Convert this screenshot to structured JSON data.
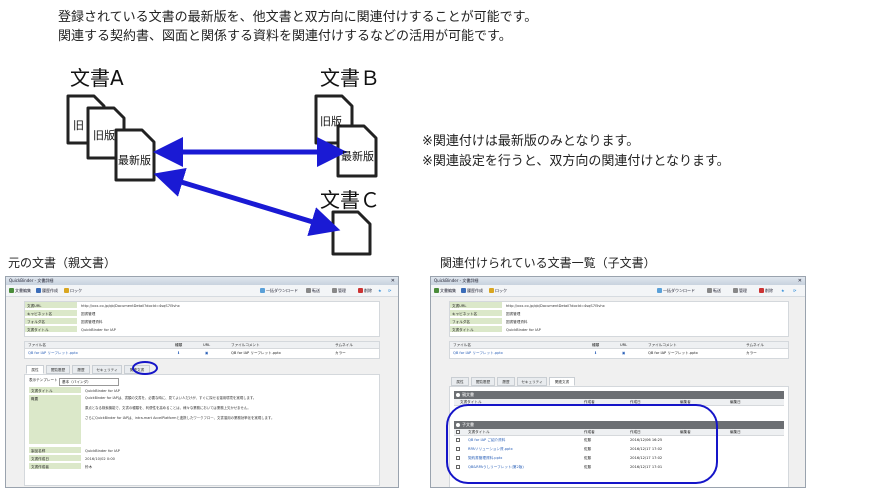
{
  "intro": {
    "line1": "登録されている文書の最新版を、他文書と双方向に関連付けすることが可能です。",
    "line2": "関連する契約書、図面と関係する資料を関連付けするなどの活用が可能です。"
  },
  "diagram": {
    "doc_a_title": "文書A",
    "doc_b_title": "文書Ｂ",
    "doc_c_title": "文書Ｃ",
    "doc_a_pages": [
      "旧",
      "旧版",
      "最新版"
    ],
    "doc_b_pages": [
      "旧版",
      "最新版"
    ],
    "arrow_color": "#1a1ad4",
    "notes": [
      "※関連付けは最新版のみとなります。",
      "※関連設定を行うと、双方向の関連付けとなります。"
    ]
  },
  "captions": {
    "left": "元の文書（親文書）",
    "right": "関連付けられている文書一覧（子文書）"
  },
  "window_common": {
    "title": "QuickBinder - 文書詳細",
    "toolbar": {
      "edit": "文書編集",
      "history": "履歴作成",
      "lock": "ロック",
      "download": "一括ダウンロード",
      "send": "転送",
      "management": "管理",
      "delete": "削除"
    },
    "props": [
      {
        "label": "文書URL",
        "value": "http://xxx.co.jp/qb/DocumentDetail?docId=4sqS7l5vhx"
      },
      {
        "label": "キャビネット名",
        "value": "図書管理"
      },
      {
        "label": "フォルダ名",
        "value": "図書管理資料"
      },
      {
        "label": "文書タイトル",
        "value": "QuickBinder for IAP"
      }
    ],
    "file_headers": [
      "ファイル名",
      "種類",
      "URL",
      "ファイルコメント",
      "サムネイル"
    ],
    "file_row": {
      "name": "QB for IAP リーフレット.pptx",
      "comment": "QB for IAP リーフレット.pptx",
      "thumb": "カラー"
    }
  },
  "left_window": {
    "tabs": [
      "属性",
      "閲覧履歴",
      "履歴",
      "セキュリティ",
      "関連文書"
    ],
    "template_label": "表示テンプレート",
    "template_value": "基本（バインダ）",
    "details": [
      {
        "label": "文書タイトル",
        "value": "QuickBinder for IAP"
      },
      {
        "label": "概要",
        "value": "QuickBinder for IAPは、書類の文書を、必要な時に、見てよい人だけが、すぐに探せる運用環境を実現します。"
      },
      {
        "label": "",
        "value": "原点となる検索機能で、文書の種類を、利便性を高めることは、様々な業務においては業務上欠かせません。"
      },
      {
        "label": "",
        "value": "さらにQuickBinder for IAPは、intra-mart AccelPlatformと連携したワークフロー、文書運用の業務効率化を実現します。"
      },
      {
        "label": "製品名称",
        "value": "QuickBinder for IAP"
      },
      {
        "label": "文書作成日",
        "value": "2016/10/02 0:00"
      },
      {
        "label": "文書作成者",
        "value": "鈴木"
      }
    ]
  },
  "right_window": {
    "tabs": [
      "属性",
      "閲覧履歴",
      "履歴",
      "セキュリティ",
      "関連文書"
    ],
    "parent_section": "親文書",
    "child_section": "子文書",
    "table_headers": [
      "文書タイトル",
      "作成者",
      "作成日",
      "編集者",
      "編集日"
    ],
    "children": [
      {
        "title": "QB for IAP ご紹介資料",
        "author": "佐藤",
        "date": "2016/12/06 16:25"
      },
      {
        "title": "RPAソリューション資.pptx",
        "author": "佐藤",
        "date": "2016/12/17 17:02"
      },
      {
        "title": "契約書管理資料.pptx",
        "author": "佐藤",
        "date": "2016/12/17 17:02"
      },
      {
        "title": "QB&RPAうしリーフレット(第2版)",
        "author": "佐藤",
        "date": "2016/12/17 17:01"
      }
    ]
  },
  "colors": {
    "label_green": "#dbe8c9",
    "highlight_blue": "#1515c8",
    "section_gray": "#6c6f73"
  }
}
